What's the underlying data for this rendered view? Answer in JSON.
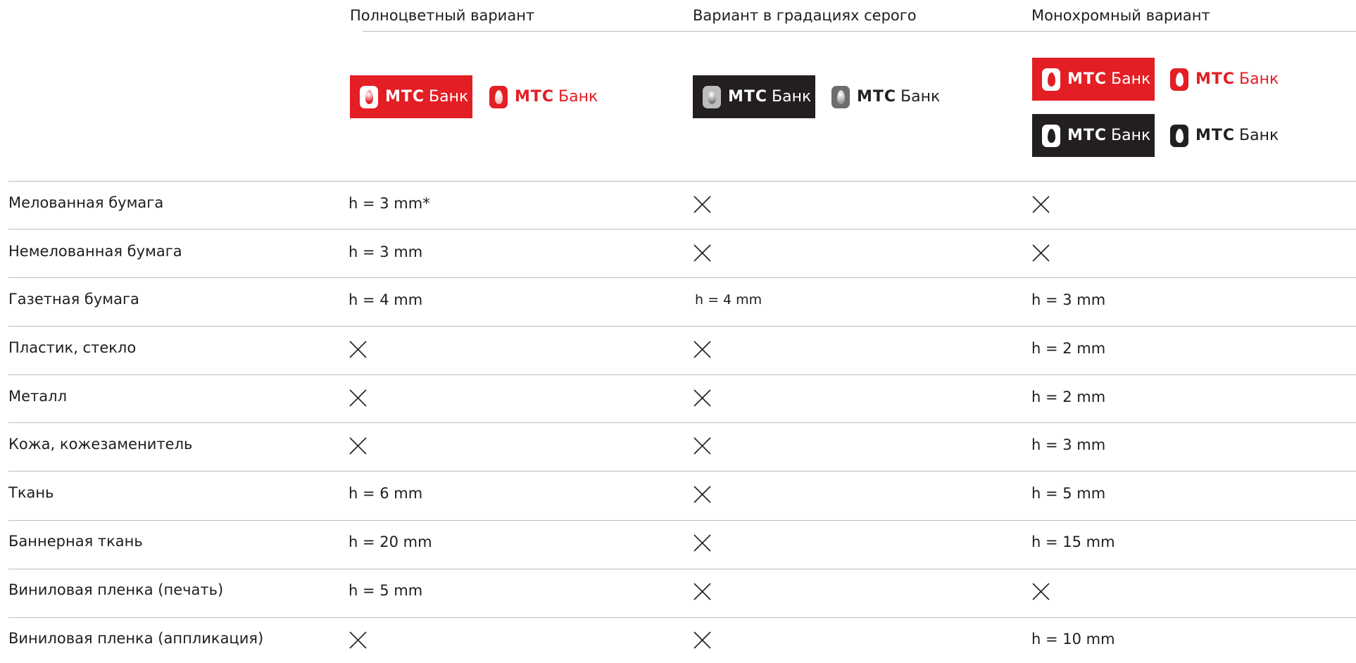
{
  "colors": {
    "brand_red": "#e31e24",
    "logo_black": "#231f20",
    "logo_gray": "#6d6d6d",
    "rule": "#bdbdbd",
    "text": "#1e1e1e"
  },
  "columns": {
    "full_color": "Полноцветный вариант",
    "grayscale": "Вариант в градациях серого",
    "mono": "Монохромный вариант"
  },
  "logo": {
    "brand": "МТС",
    "suffix": "Банк",
    "icon": "egg-icon"
  },
  "rows": [
    {
      "label": "Мелованная бумага",
      "full_color": "h = 3 mm*",
      "grayscale": "x",
      "mono": "x"
    },
    {
      "label": "Немелованная бумага",
      "full_color": "h = 3 mm",
      "grayscale": "x",
      "mono": "x"
    },
    {
      "label": "Газетная бумага",
      "full_color": "h = 4 mm",
      "grayscale": "h = 4 mm",
      "mono": "h = 3 mm"
    },
    {
      "label": "Пластик, стекло",
      "full_color": "x",
      "grayscale": "x",
      "mono": "h = 2 mm"
    },
    {
      "label": "Металл",
      "full_color": "x",
      "grayscale": "x",
      "mono": "h = 2 mm"
    },
    {
      "label": "Кожа, кожезаменитель",
      "full_color": "x",
      "grayscale": "x",
      "mono": "h = 3 mm"
    },
    {
      "label": "Ткань",
      "full_color": "h = 6 mm",
      "grayscale": "x",
      "mono": "h = 5 mm"
    },
    {
      "label": "Баннерная ткань",
      "full_color": "h = 20 mm",
      "grayscale": "x",
      "mono": "h = 15 mm"
    },
    {
      "label": "Виниловая пленка (печать)",
      "full_color": "h = 5 mm",
      "grayscale": "x",
      "mono": "x"
    },
    {
      "label": "Виниловая пленка (аппликация)",
      "full_color": "x",
      "grayscale": "x",
      "mono": "h = 10 mm"
    }
  ]
}
